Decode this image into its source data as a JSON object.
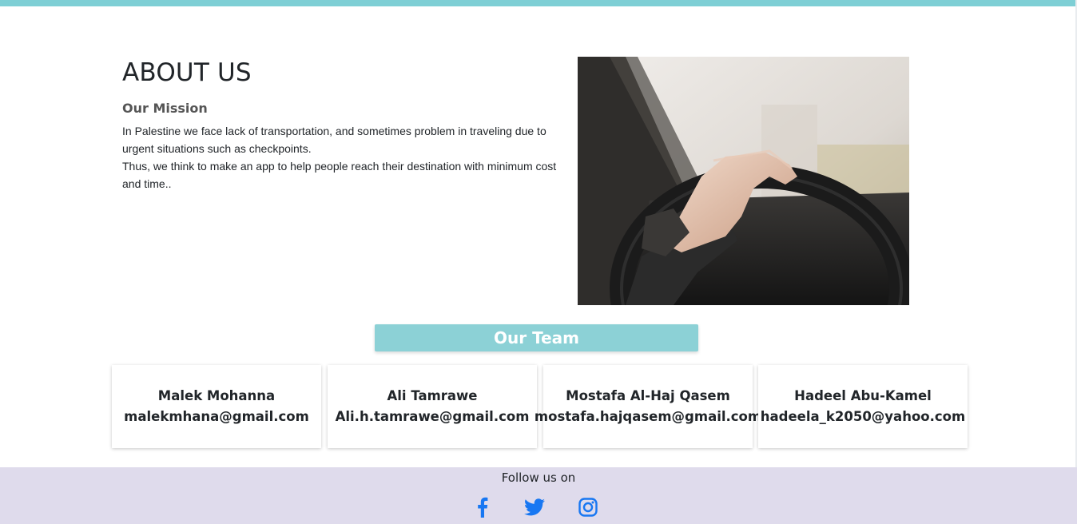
{
  "about": {
    "title": "ABOUT US",
    "mission_heading": "Our Mission",
    "mission_lines": [
      "In Palestine we face lack of transportation, and sometimes problem in traveling due to urgent situations such as checkpoints.",
      "Thus, we think to make an app to help people reach their destination with minimum cost and time.."
    ],
    "image": "hand-on-steering-wheel-photo"
  },
  "team": {
    "heading": "Our Team",
    "members": [
      {
        "name": "Malek Mohanna",
        "email": "malekmhana@gmail.com"
      },
      {
        "name": "Ali Tamrawe",
        "email": "Ali.h.tamrawe@gmail.com"
      },
      {
        "name": "Mostafa Al-Haj Qasem",
        "email": "mostafa.hajqasem@gmail.com"
      },
      {
        "name": "Hadeel Abu-Kamel",
        "email": "hadeela_k2050@yahoo.com"
      }
    ]
  },
  "footer": {
    "follow_text": "Follow us on",
    "social": [
      "facebook-icon",
      "twitter-icon",
      "instagram-icon"
    ]
  },
  "colors": {
    "accent": "#7ecfd5",
    "team_banner": "#8cd1d6",
    "footer_bg": "#dfdbec",
    "social_icon": "#1877f2"
  }
}
